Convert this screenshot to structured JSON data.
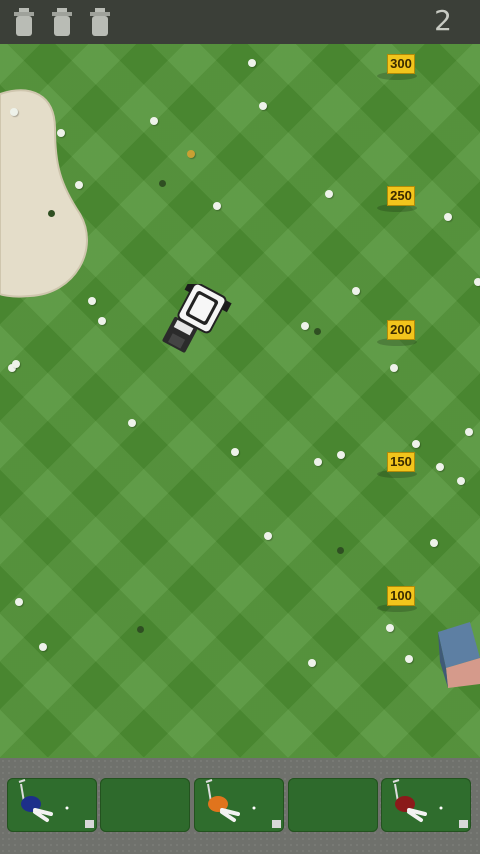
{
  "hud": {
    "score": "2",
    "lives_icon": "golf-cart-icon"
  },
  "field": {
    "distance_markers": [
      "300",
      "250",
      "200",
      "150",
      "100"
    ]
  },
  "golfers": {
    "colors": [
      "#1d2f8a",
      "#e0741d",
      "#8b1a1a"
    ]
  }
}
